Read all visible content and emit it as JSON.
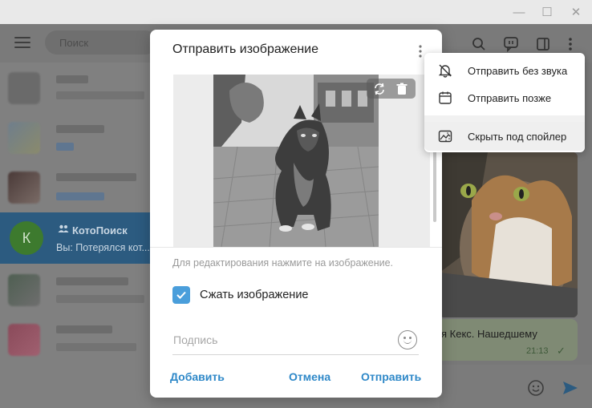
{
  "window": {
    "minimize_glyph": "—",
    "maximize_glyph": "☐",
    "close_glyph": "✕"
  },
  "topbar": {
    "search_placeholder": "Поиск",
    "icons": [
      "menu-icon",
      "search-icon",
      "voice-chat-icon",
      "sidebar-toggle-icon",
      "more-vert-icon"
    ]
  },
  "chatlist": {
    "active_chat": {
      "avatar_letter": "К",
      "name": "КотоПоиск",
      "preview": "Вы: Потерялся кот..."
    }
  },
  "conversation": {
    "message_text": "я Кекс. Нашедшему",
    "message_time": "21:13",
    "check_glyph": "✓"
  },
  "dialog": {
    "title": "Отправить изображение",
    "hint": "Для редактирования нажмите на изображение.",
    "compress_label": "Сжать изображение",
    "compress_checked": true,
    "caption_placeholder": "Подпись",
    "add_label": "Добавить",
    "cancel_label": "Отмена",
    "send_label": "Отправить"
  },
  "dropdown": {
    "items": [
      {
        "label": "Отправить без звука",
        "icon": "muted-bell-icon"
      },
      {
        "label": "Отправить позже",
        "icon": "calendar-icon"
      },
      {
        "label": "Скрыть под спойлер",
        "icon": "spoiler-icon"
      }
    ]
  },
  "colors": {
    "accent": "#2e88c8",
    "checkbox": "#4a9edb",
    "active_chat": "#2c5b80"
  }
}
